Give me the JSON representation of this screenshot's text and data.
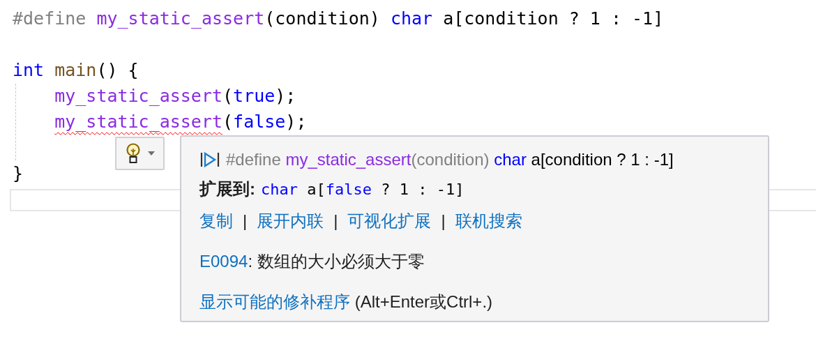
{
  "code": {
    "blocks": [
      [
        {
          "tokens": [
            {
              "text": "#define ",
              "kind": "preproc"
            },
            {
              "text": "my_static_assert",
              "kind": "macro"
            },
            {
              "text": "(condition) ",
              "kind": "plain"
            },
            {
              "text": "char",
              "kind": "keyword"
            },
            {
              "text": " a[condition ? 1 : -1]",
              "kind": "plain"
            }
          ]
        }
      ],
      [
        {
          "tokens": [
            {
              "text": "int ",
              "kind": "keyword"
            },
            {
              "text": "main",
              "kind": "func"
            },
            {
              "text": "() {",
              "kind": "plain"
            }
          ]
        },
        {
          "indent": true,
          "tokens": [
            {
              "text": "my_static_assert",
              "kind": "macro",
              "error": false
            },
            {
              "text": "(",
              "kind": "plain"
            },
            {
              "text": "true",
              "kind": "keyword"
            },
            {
              "text": ");",
              "kind": "plain"
            }
          ]
        },
        {
          "indent": true,
          "tokens": [
            {
              "text": "my_static_assert",
              "kind": "macro",
              "error": true
            },
            {
              "text": "(",
              "kind": "plain"
            },
            {
              "text": "false",
              "kind": "keyword"
            },
            {
              "text": ");",
              "kind": "plain"
            }
          ]
        }
      ],
      [
        {
          "tokens": [
            {
              "text": "}",
              "kind": "plain"
            }
          ]
        }
      ]
    ]
  },
  "quick_info": {
    "header": [
      {
        "text": "#define ",
        "kind": "preproc"
      },
      {
        "text": "my_static_assert",
        "kind": "macro"
      },
      {
        "text": "(condition) ",
        "kind": "preproc"
      },
      {
        "text": "char",
        "kind": "keyword"
      },
      {
        "text": " a[condition ? 1 : -1]",
        "kind": "plain"
      }
    ],
    "expansion": {
      "label": "扩展到:",
      "tokens": [
        {
          "text": "char",
          "kind": "keyword"
        },
        {
          "text": " a[",
          "kind": "plain"
        },
        {
          "text": "false",
          "kind": "keyword"
        },
        {
          "text": " ? 1 : -1]",
          "kind": "plain"
        }
      ]
    },
    "actions": [
      {
        "label": "复制",
        "kind": "link"
      },
      {
        "label": "|",
        "kind": "separator"
      },
      {
        "label": "展开内联",
        "kind": "link"
      },
      {
        "label": "|",
        "kind": "separator"
      },
      {
        "label": "可视化扩展",
        "kind": "link"
      },
      {
        "label": "|",
        "kind": "separator"
      },
      {
        "label": "联机搜索",
        "kind": "link"
      }
    ],
    "error": {
      "code": "E0094",
      "message": ": 数组的大小必须大于零"
    },
    "fix": {
      "link": "显示可能的修补程序",
      "hint": " (Alt+Enter或Ctrl+.)"
    }
  }
}
